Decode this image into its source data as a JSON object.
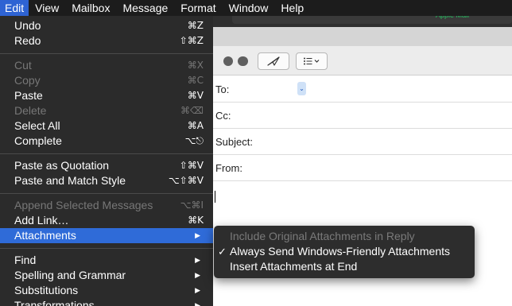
{
  "menubar": {
    "items": [
      "Edit",
      "View",
      "Mailbox",
      "Message",
      "Format",
      "Window",
      "Help"
    ]
  },
  "background": {
    "status_text": "Apple Mail"
  },
  "compose": {
    "to_label": "To:",
    "cc_label": "Cc:",
    "subject_label": "Subject:",
    "from_label": "From:"
  },
  "edit_menu": {
    "undo": {
      "label": "Undo",
      "shortcut": "⌘Z"
    },
    "redo": {
      "label": "Redo",
      "shortcut": "⇧⌘Z"
    },
    "cut": {
      "label": "Cut",
      "shortcut": "⌘X"
    },
    "copy": {
      "label": "Copy",
      "shortcut": "⌘C"
    },
    "paste": {
      "label": "Paste",
      "shortcut": "⌘V"
    },
    "delete": {
      "label": "Delete",
      "shortcut": "⌘⌫"
    },
    "select_all": {
      "label": "Select All",
      "shortcut": "⌘A"
    },
    "complete": {
      "label": "Complete",
      "shortcut": "⌥⎋"
    },
    "paste_quotation": {
      "label": "Paste as Quotation",
      "shortcut": "⇧⌘V"
    },
    "paste_match": {
      "label": "Paste and Match Style",
      "shortcut": "⌥⇧⌘V"
    },
    "append_selected": {
      "label": "Append Selected Messages",
      "shortcut": "⌥⌘I"
    },
    "add_link": {
      "label": "Add Link…",
      "shortcut": "⌘K"
    },
    "attachments": {
      "label": "Attachments"
    },
    "find": {
      "label": "Find"
    },
    "spelling": {
      "label": "Spelling and Grammar"
    },
    "substitutions": {
      "label": "Substitutions"
    },
    "transformations": {
      "label": "Transformations"
    }
  },
  "attachments_submenu": {
    "include_original": "Include Original Attachments in Reply",
    "always_send": "Always Send Windows-Friendly Attachments",
    "insert_at_end": "Insert Attachments at End",
    "check_mark": "✓"
  },
  "icons": {
    "submenu_arrow": "▶",
    "send": "paper-plane-icon",
    "format_list": "list-icon"
  },
  "colors": {
    "highlight": "#2f6bd8",
    "menu_bg": "#2b2b2b",
    "disabled_text": "#777777",
    "status_green": "#21c35f"
  }
}
